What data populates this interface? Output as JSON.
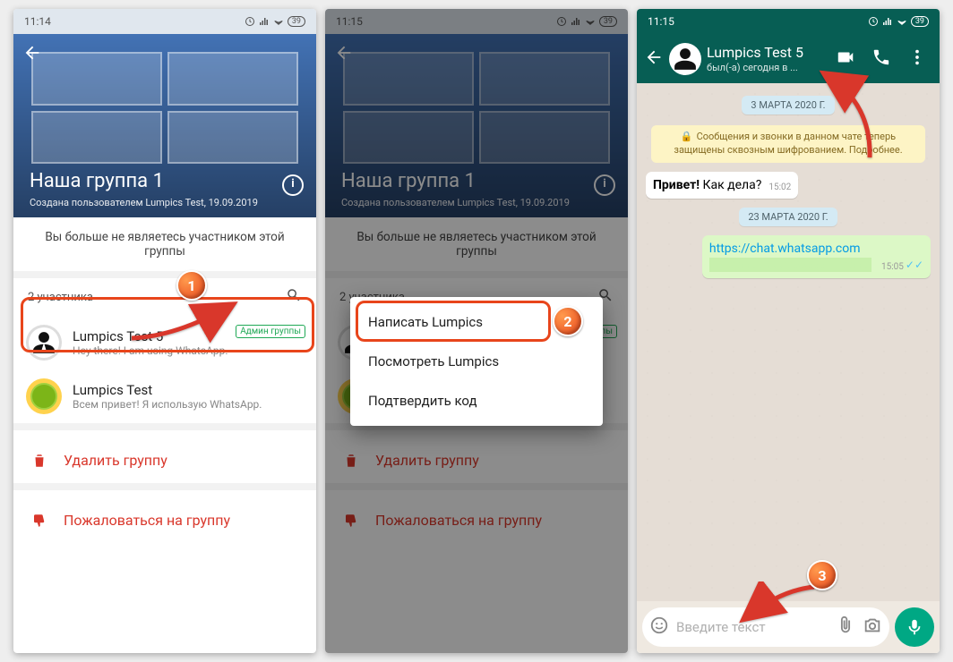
{
  "status": {
    "time1": "11:14",
    "time2": "11:15",
    "time3": "11:15",
    "battery": "39"
  },
  "hero": {
    "title": "Наша группа 1",
    "subtitle": "Создана пользователем Lumpics Test, 19.09.2019"
  },
  "notice": "Вы больше не являетесь участником этой группы",
  "participants_label": "2 участника",
  "member1": {
    "name": "Lumpics Test 5",
    "status": "Hey there! I am using WhatsApp.",
    "badge": "Админ группы"
  },
  "member2": {
    "name": "Lumpics Test",
    "status": "Всем привет! Я использую WhatsApp."
  },
  "actions": {
    "delete": "Удалить группу",
    "report": "Пожаловаться на группу"
  },
  "ctx": {
    "write": "Написать Lumpics",
    "view": "Посмотреть Lumpics",
    "confirm": "Подтвердить код"
  },
  "chat": {
    "title": "Lumpics Test 5",
    "subtitle": "был(-а) сегодня в ...",
    "date1": "3 МАРТА 2020 Г.",
    "enc": "Сообщения и звонки в данном чате теперь защищены сквозным шифрованием. Подробнее.",
    "msg1_a": "Привет!",
    "msg1_b": " Как дела?",
    "msg1_time": "15:02",
    "date2": "23 МАРТА 2020 Г.",
    "msg2_link": "https://chat.whatsapp.com",
    "msg2_time": "15:05",
    "input_ph": "Введите текст"
  },
  "markers": {
    "m1": "1",
    "m2": "2",
    "m3": "3"
  }
}
